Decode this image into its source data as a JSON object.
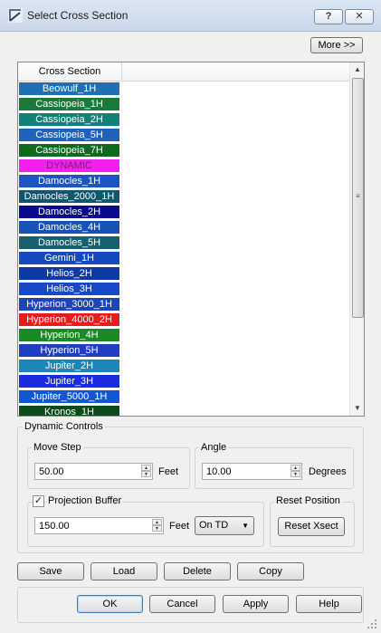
{
  "window": {
    "title": "Select Cross Section",
    "help_button": "?",
    "close_button": "✕"
  },
  "more_button": "More >>",
  "cross_section_list": {
    "column_header": "Cross Section",
    "items": [
      {
        "label": "Beowulf_1H",
        "color": "#1f6fb4"
      },
      {
        "label": "Cassiopeia_1H",
        "color": "#1a7a3a"
      },
      {
        "label": "Cassiopeia_2H",
        "color": "#13807a"
      },
      {
        "label": "Cassiopeia_5H",
        "color": "#1f62b8"
      },
      {
        "label": "Cassiopeia_7H",
        "color": "#0f6a1e"
      },
      {
        "label": "DYNAMIC",
        "color": "#f21ff0",
        "text_color": "#6a2a6a"
      },
      {
        "label": "Damocles_1H",
        "color": "#1d54c3"
      },
      {
        "label": "Damocles_2000_1H",
        "color": "#12566e"
      },
      {
        "label": "Damocles_2H",
        "color": "#0a0a8a"
      },
      {
        "label": "Damocles_4H",
        "color": "#1753b3"
      },
      {
        "label": "Damocles_5H",
        "color": "#176070"
      },
      {
        "label": "Gemini_1H",
        "color": "#1449c0"
      },
      {
        "label": "Helios_2H",
        "color": "#0e3aa8"
      },
      {
        "label": "Helios_3H",
        "color": "#1748c8"
      },
      {
        "label": "Hyperion_3000_1H",
        "color": "#1f43b8"
      },
      {
        "label": "Hyperion_4000_2H",
        "color": "#e81c1c"
      },
      {
        "label": "Hyperion_4H",
        "color": "#1a8a26"
      },
      {
        "label": "Hyperion_5H",
        "color": "#1f3ec2"
      },
      {
        "label": "Jupiter_2H",
        "color": "#1d86b8"
      },
      {
        "label": "Jupiter_3H",
        "color": "#1a2be0"
      },
      {
        "label": "Jupiter_5000_1H",
        "color": "#1157d4"
      },
      {
        "label": "Kronos_1H",
        "color": "#0c4a1c"
      }
    ]
  },
  "dynamic_controls": {
    "title": "Dynamic Controls",
    "move_step": {
      "label": "Move Step",
      "value": "50.00",
      "unit": "Feet"
    },
    "angle": {
      "label": "Angle",
      "value": "10.00",
      "unit": "Degrees"
    },
    "projection_buffer": {
      "label": "Projection Buffer",
      "checked": true,
      "value": "150.00",
      "unit": "Feet",
      "mode": "On TD"
    },
    "reset_position": {
      "label": "Reset Position",
      "button": "Reset Xsect"
    }
  },
  "actions": {
    "save": "Save",
    "load": "Load",
    "delete": "Delete",
    "copy": "Copy"
  },
  "dialog_buttons": {
    "ok": "OK",
    "cancel": "Cancel",
    "apply": "Apply",
    "help": "Help"
  }
}
